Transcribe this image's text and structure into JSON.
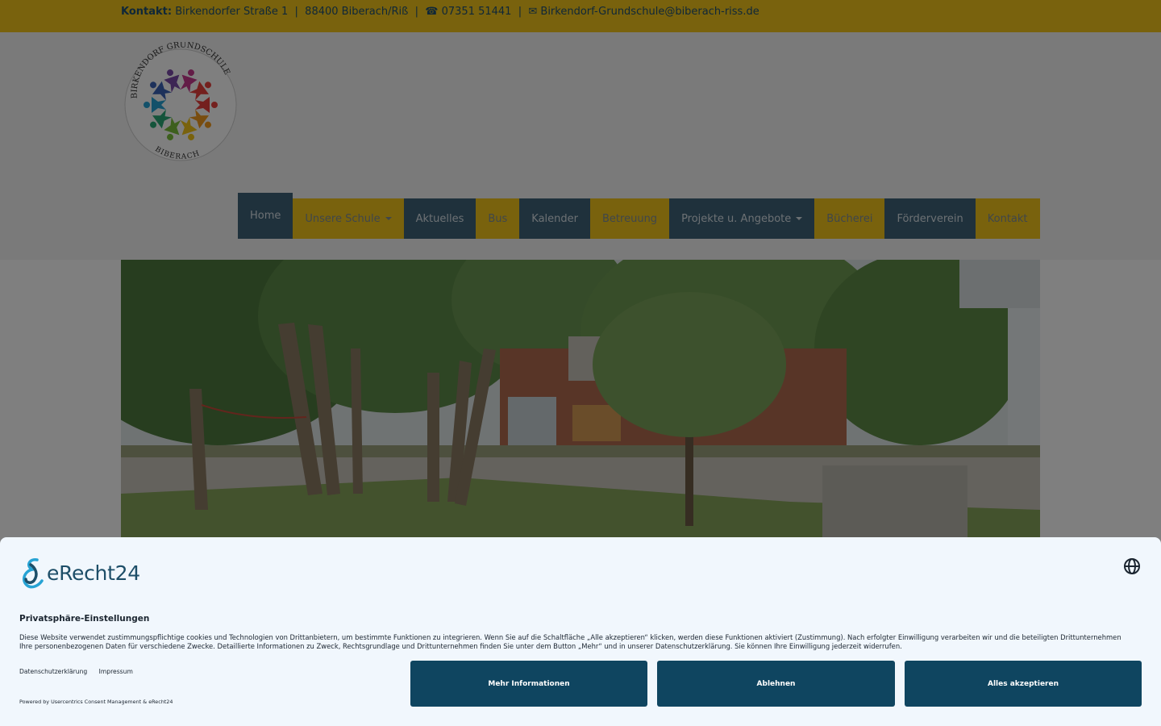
{
  "topbar": {
    "label": "Kontakt:",
    "address": "Birkendorfer Straße 1",
    "city": "88400 Biberach/Riß",
    "phone": "☎ 07351 51441",
    "email": "✉ Birkendorf-Grundschule@biberach-riss.de",
    "separator": "|"
  },
  "logo": {
    "top_text": "BIRKENDORF GRUNDSCHULE",
    "bottom_text": "BIBERACH"
  },
  "nav": {
    "items": [
      {
        "label": "Home",
        "style": "blue"
      },
      {
        "label": "Unsere Schule",
        "style": "yellow",
        "dropdown": true
      },
      {
        "label": "Aktuelles",
        "style": "blue"
      },
      {
        "label": "Bus",
        "style": "yellow"
      },
      {
        "label": "Kalender",
        "style": "blue"
      },
      {
        "label": "Betreuung",
        "style": "yellow"
      },
      {
        "label": "Projekte u. Angebote",
        "style": "blue",
        "dropdown": true
      },
      {
        "label": "Bücherei",
        "style": "yellow"
      },
      {
        "label": "Förderverein",
        "style": "blue"
      },
      {
        "label": "Kontakt",
        "style": "yellow"
      }
    ]
  },
  "consent": {
    "brand": "eRecht24",
    "title": "Privatsphäre-Einstellungen",
    "text": "Diese Website verwendet zustimmungspflichtige cookies und Technologien von Drittanbietern, um bestimmte Funktionen zu integrieren. Wenn Sie auf die Schaltfläche „Alle akzeptieren“ klicken, werden diese Funktionen aktiviert (Zustimmung). Nach erfolgter Einwilligung verarbeiten wir und die beteiligten Drittunternehmen Ihre personenbezogenen Daten für verschiedene Zwecke. Detaillierte Informationen zu Zweck, Rechtsgrundlage und Drittunternehmen finden Sie unter dem Button „Mehr“ und in unserer Datenschutzerklärung. Sie können Ihre Einwilligung jederzeit widerrufen.",
    "link_privacy": "Datenschutzerklärung",
    "link_imprint": "Impressum",
    "powered": "Powered by Usercentrics Consent Management & eRecht24",
    "btn_more": "Mehr Informationen",
    "btn_decline": "Ablehnen",
    "btn_accept": "Alles akzeptieren"
  },
  "colors": {
    "yellow": "#f2c51a",
    "blue": "#3f6279",
    "consent_button": "#0f4560",
    "consent_bg": "#f1f7fd"
  }
}
